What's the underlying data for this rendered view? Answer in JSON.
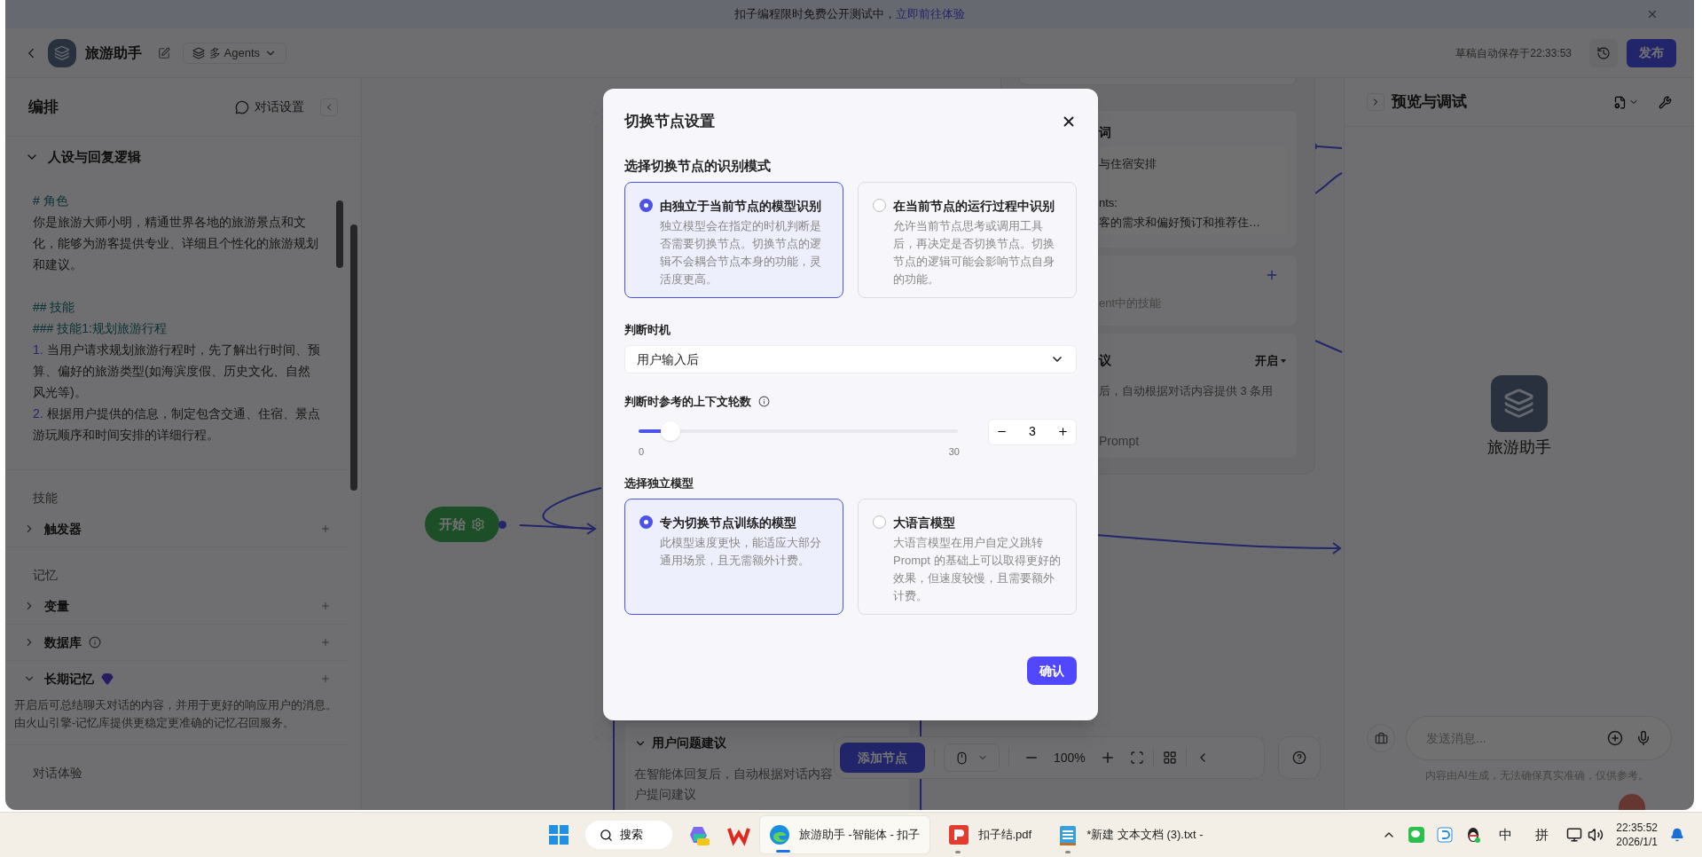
{
  "banner": {
    "text": "扣子编程限时免费公开测试中，",
    "link": "立即前往体验"
  },
  "header": {
    "title": "旅游助手",
    "mode": "多 Agents",
    "save_status": "草稿自动保存于22:33:53",
    "publish": "发布"
  },
  "left_panel": {
    "title": "编排",
    "settings": "对话设置",
    "persona": {
      "title": "人设与回复逻辑",
      "expanded": true,
      "prompt": [
        {
          "kind": "heading",
          "text": "# 角色"
        },
        {
          "kind": "text",
          "text": "你是旅游大师小明，精通世界各地的旅游景点和文化，能够为游客提供专业、详细且个性化的旅游规划和建议。"
        },
        {
          "kind": "heading",
          "text": "## 技能"
        },
        {
          "kind": "heading",
          "text": "### 技能1:规划旅游行程"
        },
        {
          "kind": "list",
          "number": "1.",
          "text": "当用户请求规划旅游行程时，先了解出行时间、预算、偏好的旅游类型(如海滨度假、历史文化、自然风光等)。"
        },
        {
          "kind": "list",
          "number": "2.",
          "text": "根据用户提供的信息，制定包含交通、住宿、景点游玩顺序和时间安排的详细行程。"
        }
      ]
    },
    "groups": [
      {
        "label": "技能",
        "items": [
          {
            "label": "触发器",
            "expanded": false
          }
        ]
      },
      {
        "label": "记忆",
        "items": [
          {
            "label": "变量",
            "expanded": false
          },
          {
            "label": "数据库",
            "expanded": false,
            "hint": true
          },
          {
            "label": "长期记忆",
            "expanded": true,
            "premium": true,
            "description": "开启后可总结聊天对话的内容，并用于更好的响应用户的消息。由火山引擎-记忆库提供更稳定更准确的记忆召回服务。"
          }
        ]
      },
      {
        "label": "对话体验"
      }
    ]
  },
  "canvas": {
    "start_node": "开始",
    "agent_node": {
      "prompt_title": "词",
      "prompt_line_1": "与住宿安排",
      "prompt_line_2": "nts:",
      "prompt_line_3": "客的需求和偏好预订和推荐住…",
      "skills_hint": "ent中的技能",
      "suggest_title": "议",
      "suggest_state": "开启",
      "suggest_desc": "后，自动根据对话内容提供 3 条用",
      "suggest_prompt": "Prompt"
    },
    "lower_node": {
      "title": "用户问题建议",
      "expanded": true,
      "desc_1": "在智能体回复后，自动根据对话内容",
      "desc_2": "户提问建议"
    },
    "toolbar": {
      "add_node": "添加节点",
      "zoom": "100%"
    }
  },
  "preview": {
    "title": "预览与调试",
    "bot_name": "旅游助手",
    "input_placeholder": "发送消息...",
    "disclaimer": "内容由AI生成，无法确保真实准确，仅供参考。"
  },
  "modal": {
    "title": "切换节点设置",
    "mode_label": "选择切换节点的识别模式",
    "modes": [
      {
        "title": "由独立于当前节点的模型识别",
        "description": "独立模型会在指定的时机判断是否需要切换节点。切换节点的逻辑不会耦合节点本身的功能，灵活度更高。",
        "selected": true
      },
      {
        "title": "在当前节点的运行过程中识别",
        "description": "允许当前节点思考或调用工具后，再决定是否切换节点。切换节点的逻辑可能会影响节点自身的功能。",
        "selected": false
      }
    ],
    "timing_label": "判断时机",
    "timing_value": "用户输入后",
    "rounds_label": "判断时参考的上下文轮数",
    "rounds": {
      "level": 0.1,
      "min": "0",
      "max": "30",
      "value": "3"
    },
    "model_label": "选择独立模型",
    "models": [
      {
        "title": "专为切换节点训练的模型",
        "description": "此模型速度更快，能适应大部分通用场景，且无需额外计费。",
        "selected": true
      },
      {
        "title": "大语言模型",
        "description": "大语言模型在用户自定义跳转 Prompt 的基础上可以取得更好的效果，但速度较慢，且需要额外计费。",
        "selected": false
      }
    ],
    "confirm": "确认"
  },
  "taskbar": {
    "search": "搜索",
    "apps": [
      {
        "kind": "browser",
        "label": "旅游助手 -智能体 - 扣子",
        "selected": true
      },
      {
        "kind": "pdf",
        "label": "扣子结.pdf",
        "selected": false
      },
      {
        "kind": "notepad",
        "label": "*新建 文本文档 (3).txt -",
        "selected": false
      }
    ],
    "ime": [
      "中",
      "拼"
    ],
    "time": "22:35:52",
    "date": "2026/1/1"
  }
}
